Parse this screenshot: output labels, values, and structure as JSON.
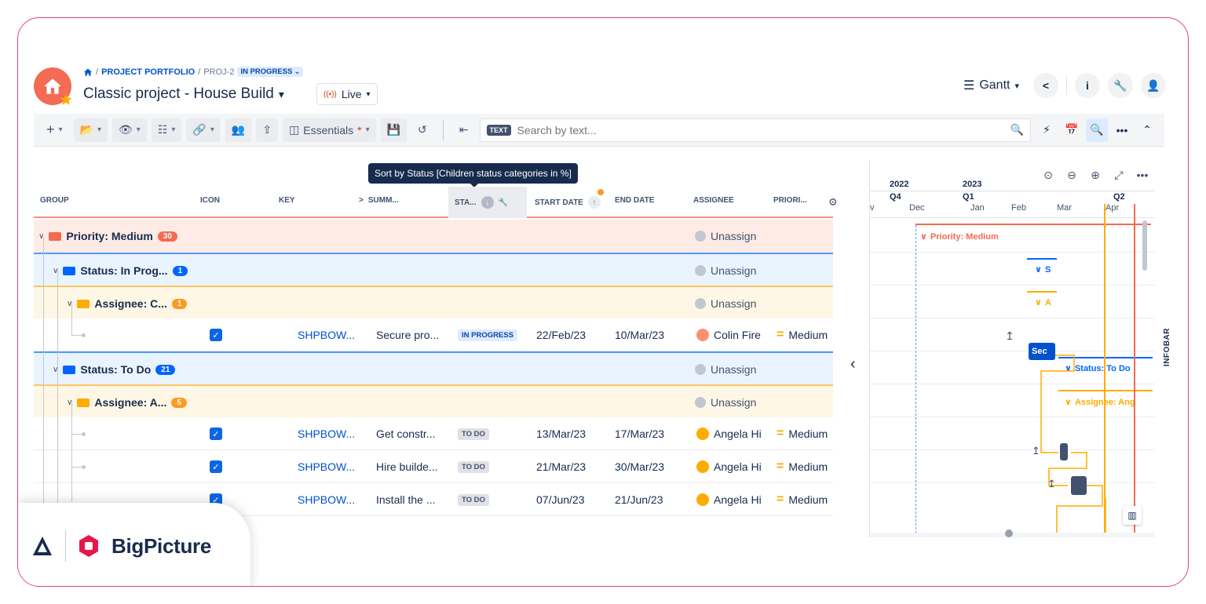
{
  "header": {
    "breadcrumb_portfolio": "PROJECT PORTFOLIO",
    "breadcrumb_project": "PROJ-2",
    "status_badge": "IN PROGRESS",
    "title": "Classic project - House Build",
    "live_label": "Live",
    "view_label": "Gantt"
  },
  "toolbar": {
    "essentials_label": "Essentials",
    "text_chip": "TEXT",
    "search_placeholder": "Search by text..."
  },
  "tooltip": "Sort by Status [Children status categories in %]",
  "columns": {
    "group": "GROUP",
    "icon": "ICON",
    "key": "KEY",
    "summary": "SUMM...",
    "status": "STA...",
    "start": "START DATE",
    "end": "END DATE",
    "assignee": "ASSIGNEE",
    "priority": "PRIORI..."
  },
  "groups": {
    "priority": {
      "label": "Priority: Medium",
      "count": "30",
      "assignee": "Unassign"
    },
    "status_prog": {
      "label": "Status: In Prog...",
      "count": "1",
      "assignee": "Unassign"
    },
    "assignee_c": {
      "label": "Assignee: C...",
      "count": "1",
      "assignee": "Unassign"
    },
    "status_todo": {
      "label": "Status: To Do",
      "count": "21",
      "assignee": "Unassign"
    },
    "assignee_a": {
      "label": "Assignee: A...",
      "count": "5",
      "assignee": "Unassign"
    }
  },
  "tasks": [
    {
      "key": "SHPBOW...",
      "summary": "Secure pro...",
      "status": "IN PROGRESS",
      "start": "22/Feb/23",
      "end": "10/Mar/23",
      "assignee": "Colin Fire",
      "priority": "Medium"
    },
    {
      "key": "SHPBOW...",
      "summary": "Get constr...",
      "status": "TO DO",
      "start": "13/Mar/23",
      "end": "17/Mar/23",
      "assignee": "Angela Hi",
      "priority": "Medium"
    },
    {
      "key": "SHPBOW...",
      "summary": "Hire builde...",
      "status": "TO DO",
      "start": "21/Mar/23",
      "end": "30/Mar/23",
      "assignee": "Angela Hi",
      "priority": "Medium"
    },
    {
      "key": "SHPBOW...",
      "summary": "Install the ...",
      "status": "TO DO",
      "start": "07/Jun/23",
      "end": "21/Jun/23",
      "assignee": "Angela Hi",
      "priority": "Medium"
    }
  ],
  "gantt": {
    "years": [
      "2022",
      "2023"
    ],
    "quarters": [
      "Q4",
      "Q1",
      "Q2"
    ],
    "months": [
      "v",
      "Dec",
      "Jan",
      "Feb",
      "Mar",
      "Apr"
    ],
    "label_priority": "Priority: Medium",
    "label_status_s": "S",
    "label_assignee_a": "A",
    "task_label": "Sec",
    "label_status_todo": "Status: To Do",
    "label_assignee_ang": "Assignee: Ang",
    "infobar": "INFOBAR"
  },
  "brand": {
    "name": "BigPicture"
  }
}
